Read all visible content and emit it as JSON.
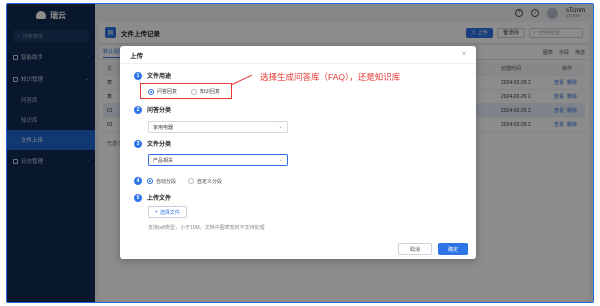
{
  "app": {
    "logo_text": "瑞云"
  },
  "sidebar": {
    "search_placeholder": "搜索菜单",
    "items": [
      {
        "label": "智能助手"
      },
      {
        "label": "知识管理"
      },
      {
        "label": "日志管理"
      }
    ],
    "sub_items": [
      {
        "label": "问答库"
      },
      {
        "label": "知识库"
      },
      {
        "label": "文件上传",
        "active": true
      }
    ]
  },
  "topbar": {
    "user_name": "sTcmm",
    "user_role": "sTcmm"
  },
  "page": {
    "title": "文件上传记录",
    "upload_button": "上传",
    "delete_button": "删除",
    "search_placeholder": "文件名检索"
  },
  "table": {
    "tab_default": "默认视图",
    "tools": [
      "图表",
      "字段",
      "筛选"
    ],
    "headers": [
      "文",
      "创建时间",
      "操作"
    ],
    "rows": [
      {
        "idx": "表",
        "time": "2024-02-29 2",
        "actions": [
          "查看",
          "删除"
        ]
      },
      {
        "idx": "表",
        "time": "2024-02-29 2",
        "actions": [
          "查看",
          "删除"
        ]
      },
      {
        "idx": "01",
        "time": "2024-02-29 2",
        "actions": [
          "查看",
          "删除"
        ],
        "selected": true
      },
      {
        "idx": "01",
        "time": "2024-02-29 2",
        "actions": [
          "查看",
          "删除"
        ]
      }
    ],
    "footer": "已选 0"
  },
  "modal": {
    "title": "上传",
    "step1": {
      "num": "1",
      "label": "文件用途",
      "options": [
        "问答回复",
        "知识回复"
      ],
      "selected": "问答回复"
    },
    "step2": {
      "num": "2",
      "label": "问答分类",
      "value": "家用电器"
    },
    "step3": {
      "num": "3",
      "label": "文件分类",
      "value": "产品相关"
    },
    "step4": {
      "num": "4",
      "options": [
        "自动分段",
        "自定义分段"
      ],
      "selected": "自动分段"
    },
    "step5": {
      "num": "5",
      "label": "上传文件",
      "button": "选择文件",
      "tip": "支持pdf类型，小于10M，文档中图表暂时不支持处理"
    },
    "cancel": "取消",
    "confirm": "确定"
  },
  "annotation": {
    "text": "选择生成问答库（FAQ），还是知识库",
    "color": "#e53935"
  },
  "colors": {
    "accent": "#2e74e6",
    "sidebar": "#0f2a4f"
  }
}
